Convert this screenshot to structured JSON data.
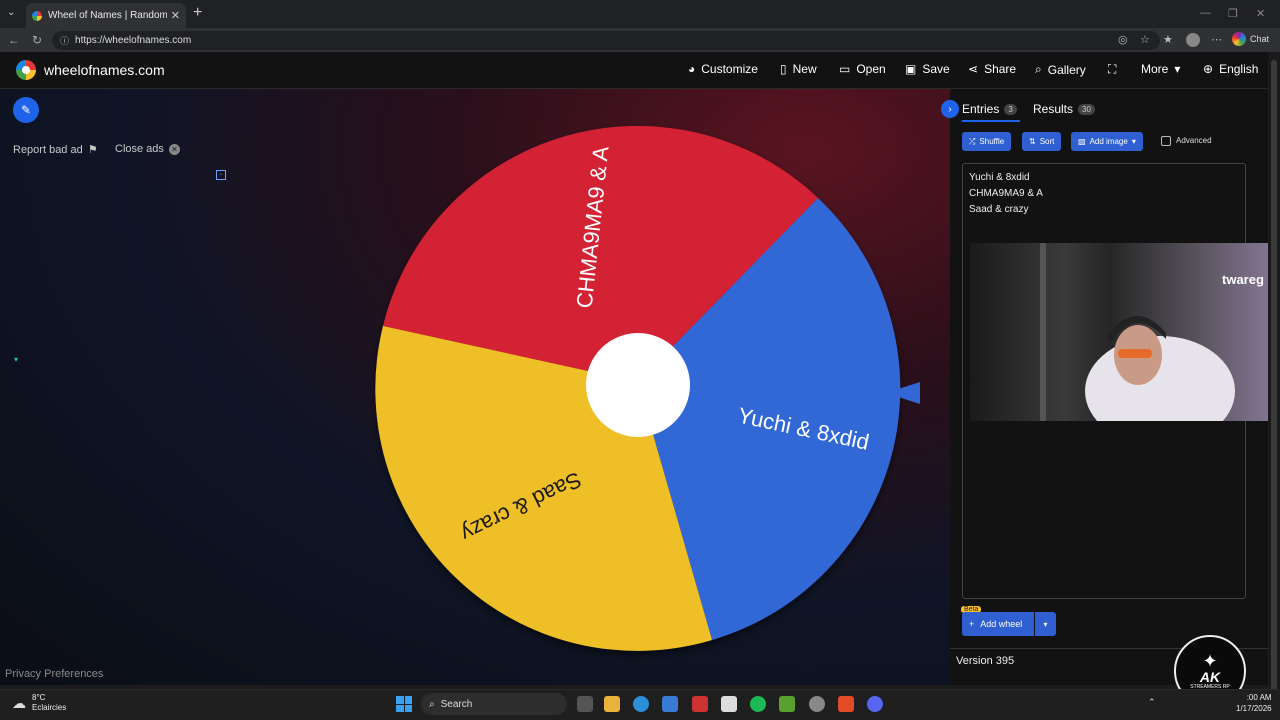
{
  "browser": {
    "tab_title": "Wheel of Names | Random name",
    "url": "https://wheelofnames.com",
    "chat_label": "Chat"
  },
  "header": {
    "site_name": "wheelofnames.com",
    "buttons": {
      "customize": "Customize",
      "new": "New",
      "open": "Open",
      "save": "Save",
      "share": "Share",
      "gallery": "Gallery",
      "more": "More",
      "language": "English"
    }
  },
  "ads": {
    "report": "Report bad ad",
    "close": "Close ads"
  },
  "privacy": "Privacy Preferences",
  "wheel": {
    "colors": {
      "red": "#d42035",
      "blue": "#3367d6",
      "yellow": "#eebf28",
      "pointer": "#3367d6"
    },
    "segments": [
      {
        "label": "CHMA9MA9 & A",
        "color": "#d42035"
      },
      {
        "label": "Yuchi & 8xdid",
        "color": "#3367d6"
      },
      {
        "label": "Saad & crazy",
        "color": "#eebf28"
      }
    ]
  },
  "panel": {
    "tabs": {
      "entries": "Entries",
      "entries_count": "3",
      "results": "Results",
      "results_count": "30"
    },
    "toolbar": {
      "shuffle": "Shuffle",
      "sort": "Sort",
      "add_image": "Add image",
      "advanced": "Advanced"
    },
    "entries": [
      "Yuchi & 8xdid",
      "CHMA9MA9 & A",
      "Saad & crazy"
    ],
    "beta": "Beta",
    "add_wheel": "Add wheel",
    "version": "Version 395"
  },
  "overlay": {
    "webcam_brand": "twareg",
    "badge_name": "AK",
    "badge_sub": "STREAMERS RP"
  },
  "taskbar": {
    "temperature": "8°C",
    "condition": "Eclaircies",
    "search": "Search",
    "time": ":00 AM",
    "date": "1/17/2026"
  }
}
